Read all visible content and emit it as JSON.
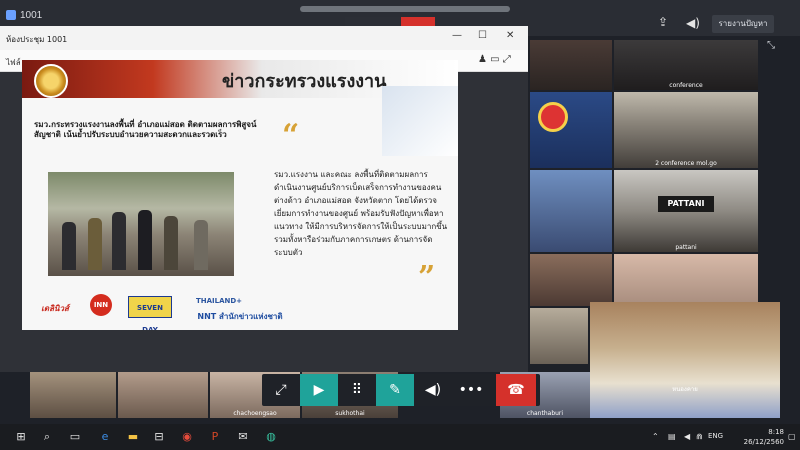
{
  "app": {
    "title": "1001"
  },
  "topbar": {
    "report_button": "รายงานปัญหา"
  },
  "share_window": {
    "title": "ห้องประชุม 1001",
    "subtitle": "ไฟล์"
  },
  "slide": {
    "title": "ข่าวกระทรวงแรงงาน",
    "lede": "รมว.กระทรวงแรงงานลงพื้นที่ อำเภอแม่สอด ติดตามผลการพิสูจน์สัญชาติ เน้นย้ำปรับระบบอำนวยความสะดวกและรวดเร็ว",
    "body": "รมว.แรงงาน และคณะ ลงพื้นที่ติดตามผลการดำเนินงานศูนย์บริการเบ็ดเสร็จการทำงานของคนต่างด้าว อำเภอแม่สอด จังหวัดตาก โดยได้ตรวจเยี่ยมการทำงานของศูนย์ พร้อมรับฟังปัญหาเพื่อหาแนวทาง ให้มีการบริหารจัดการให้เป็นระบบมากขึ้น รวมทั้งหารือร่วมกับภาคการเกษตร ด้านการจัดระบบตัว",
    "logos": [
      "เดลินิวส์",
      "INN",
      "SEVEN DAY",
      "THAILAND+",
      "NNT สำนักข่าวแห่งชาติ"
    ]
  },
  "participants": [
    "conference",
    "2 conference mol.go",
    "PATTANI",
    "pattani",
    "chachoengsao",
    "sukhothai",
    "chanthaburi",
    "หนองคาย"
  ],
  "taskbar": {
    "time": "8:18",
    "date": "26/12/2560",
    "lang": "ENG"
  }
}
